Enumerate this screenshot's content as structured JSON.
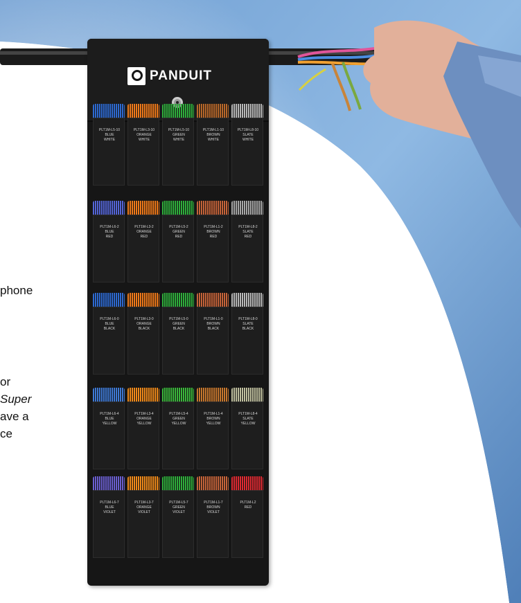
{
  "side_text": {
    "line1": "phone",
    "line2": "or",
    "line3": "Super",
    "line4": "ave a",
    "line5": "ce"
  },
  "organizer": {
    "brand": "PANDUIT"
  },
  "pockets": [
    [
      {
        "label": "PLT1M-L5-10\nBLUE\nWHITE",
        "color": "#2e6ad1"
      },
      {
        "label": "PLT1M-L3-10\nORANGE\nWHITE",
        "color": "#f07a1a"
      },
      {
        "label": "PLT1M-L5-10\nGREEN\nWHITE",
        "color": "#2fae3c"
      },
      {
        "label": "PLT1M-L1-10\nBROWN\nWHITE",
        "color": "#b8682a"
      },
      {
        "label": "PLT1M-L8-10\nSLATE\nWHITE",
        "color": "#b9b9b9"
      }
    ],
    [
      {
        "label": "PLT1M-L6-2\nBLUE\nRED",
        "color": "#5566d8"
      },
      {
        "label": "PLT1M-L3-2\nORANGE\nRED",
        "color": "#f07a1a"
      },
      {
        "label": "PLT1M-L5-2\nGREEN\nRED",
        "color": "#2fae3c"
      },
      {
        "label": "PLT1M-L1-2\nBROWN\nRED",
        "color": "#c6643a"
      },
      {
        "label": "PLT1M-L8-2\nSLATE\nRED",
        "color": "#a8a8a8"
      }
    ],
    [
      {
        "label": "PLT1M-L6-0\nBLUE\nBLACK",
        "color": "#2e6ad1"
      },
      {
        "label": "PLT1M-L3-0\nORANGE\nBLACK",
        "color": "#f07a1a"
      },
      {
        "label": "PLT1M-L5-0\nGREEN\nBLACK",
        "color": "#2fae3c"
      },
      {
        "label": "PLT1M-L1-0\nBROWN\nBLACK",
        "color": "#c6643a"
      },
      {
        "label": "PLT1M-L8-0\nSLATE\nBLACK",
        "color": "#b9b9b9"
      }
    ],
    [
      {
        "label": "PLT1M-L6-4\nBLUE\nYELLOW",
        "color": "#3f7ad6"
      },
      {
        "label": "PLT1M-L3-4\nORANGE\nYELLOW",
        "color": "#f08a1a"
      },
      {
        "label": "PLT1M-L5-4\nGREEN\nYELLOW",
        "color": "#3bb83c"
      },
      {
        "label": "PLT1M-L1-4\nBROWN\nYELLOW",
        "color": "#c8782e"
      },
      {
        "label": "PLT1M-L8-4\nSLATE\nYELLOW",
        "color": "#c1c1a0"
      }
    ],
    [
      {
        "label": "PLT1M-L6-7\nBLUE\nVIOLET",
        "color": "#6b5fd0"
      },
      {
        "label": "PLT1M-L3-7\nORANGE\nVIOLET",
        "color": "#f08a1a"
      },
      {
        "label": "PLT1M-L5-7\nGREEN\nVIOLET",
        "color": "#2fae3c"
      },
      {
        "label": "PLT1M-L1-7\nBROWN\nVIOLET",
        "color": "#c6643a"
      },
      {
        "label": "PLT1M-L2\nRED",
        "color": "#e02a32"
      }
    ]
  ]
}
